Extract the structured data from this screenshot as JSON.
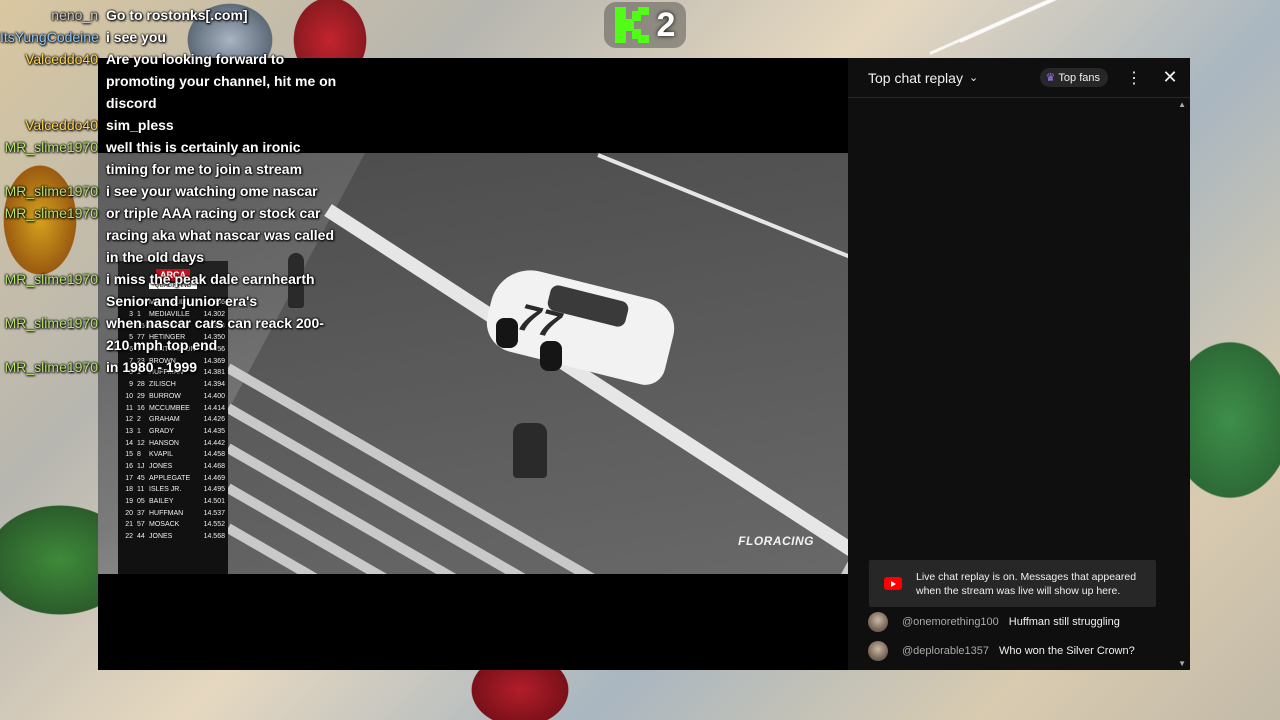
{
  "kick_badge": {
    "count": "2"
  },
  "overlay_chat": [
    {
      "user": "neno_n",
      "user_color": "#c8c8c8",
      "message": "Go to rostonks[.com]"
    },
    {
      "user": "ItsYungCodeine",
      "user_color": "#8cc8ff",
      "message": "i see you"
    },
    {
      "user": "Valceddo40",
      "user_color": "#ffd54f",
      "message": "Are you looking forward to promoting your channel, hit me on discord"
    },
    {
      "user": "Valceddo40",
      "user_color": "#ffd54f",
      "message": "sim_pless"
    },
    {
      "user": "MR_slime1970",
      "user_color": "#b6e36b",
      "message": "well this is certainly an ironic timing for me to join a stream"
    },
    {
      "user": "MR_slime1970",
      "user_color": "#b6e36b",
      "message": "i see your watching ome nascar"
    },
    {
      "user": "MR_slime1970",
      "user_color": "#b6e36b",
      "message": "or triple AAA racing or stock car racing aka what nascar was called in the old days"
    },
    {
      "user": "MR_slime1970",
      "user_color": "#b6e36b",
      "message": "i miss the peak dale earnhearth Senior and junior era's"
    },
    {
      "user": "MR_slime1970",
      "user_color": "#b6e36b",
      "message": "when nascar cars can reack 200-210 mph top end"
    },
    {
      "user": "MR_slime1970",
      "user_color": "#b6e36b",
      "message": "in 1980 - 1999"
    }
  ],
  "video": {
    "watermark": "FLORACING",
    "car_number": "77"
  },
  "leaderboard": {
    "logo": "ARCA",
    "session": "QUALIFYING",
    "rows": [
      {
        "pos": "2",
        "car": "28",
        "name": "MCCASKILL",
        "time": "14.286"
      },
      {
        "pos": "3",
        "car": "1",
        "name": "MEDIAVILLE",
        "time": "14.302"
      },
      {
        "pos": "4",
        "car": "55",
        "name": "ROBUSTIS",
        "time": "14.344"
      },
      {
        "pos": "5",
        "car": "77",
        "name": "HETINGER",
        "time": "14.350"
      },
      {
        "pos": "6",
        "car": "7",
        "name": "HUNTINGTON",
        "time": "14.356"
      },
      {
        "pos": "7",
        "car": "23",
        "name": "BROWN",
        "time": "14.369"
      },
      {
        "pos": "8",
        "car": "1",
        "name": "HUFFMAN",
        "time": "14.381"
      },
      {
        "pos": "9",
        "car": "28",
        "name": "ZILISCH",
        "time": "14.394"
      },
      {
        "pos": "10",
        "car": "29",
        "name": "BURROW",
        "time": "14.400"
      },
      {
        "pos": "11",
        "car": "16",
        "name": "MCCUMBEE",
        "time": "14.414"
      },
      {
        "pos": "12",
        "car": "2",
        "name": "GRAHAM",
        "time": "14.426"
      },
      {
        "pos": "13",
        "car": "1",
        "name": "GRADY",
        "time": "14.435"
      },
      {
        "pos": "14",
        "car": "12",
        "name": "HANSON",
        "time": "14.442"
      },
      {
        "pos": "15",
        "car": "8",
        "name": "KVAPIL",
        "time": "14.458"
      },
      {
        "pos": "16",
        "car": "1J",
        "name": "JONES",
        "time": "14.468"
      },
      {
        "pos": "17",
        "car": "45",
        "name": "APPLEGATE",
        "time": "14.469"
      },
      {
        "pos": "18",
        "car": "11",
        "name": "ISLES JR.",
        "time": "14.495"
      },
      {
        "pos": "19",
        "car": "05",
        "name": "BAILEY",
        "time": "14.501"
      },
      {
        "pos": "20",
        "car": "37",
        "name": "HUFFMAN",
        "time": "14.537"
      },
      {
        "pos": "21",
        "car": "57",
        "name": "MOSACK",
        "time": "14.552"
      },
      {
        "pos": "22",
        "car": "44",
        "name": "JONES",
        "time": "14.568"
      }
    ]
  },
  "chat_panel": {
    "title": "Top chat replay",
    "top_fans_label": "Top fans",
    "replay_notice": "Live chat replay is on. Messages that appeared when the stream was live will show up here.",
    "messages": [
      {
        "author": "@onemorething100",
        "text": "Huffman still struggling"
      },
      {
        "author": "@deplorable1357",
        "text": "Who won the Silver Crown?"
      }
    ]
  }
}
